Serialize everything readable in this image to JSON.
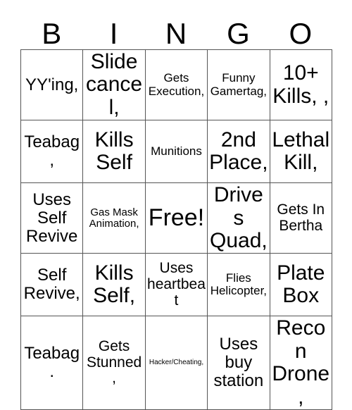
{
  "card": {
    "header_letters": [
      "B",
      "I",
      "N",
      "G",
      "O"
    ],
    "rows": [
      [
        {
          "text": "YY'ing,",
          "size": "xl"
        },
        {
          "text": "Slide cancel,",
          "size": "xxl"
        },
        {
          "text": "Gets Execution,",
          "size": "md"
        },
        {
          "text": "Funny Gamertag,",
          "size": "md"
        },
        {
          "text": "10+ Kills, ,",
          "size": "xxl"
        }
      ],
      [
        {
          "text": "Teabag,",
          "size": "xl"
        },
        {
          "text": "Kills Self",
          "size": "xxl"
        },
        {
          "text": "Munitions",
          "size": "md"
        },
        {
          "text": "2nd Place,",
          "size": "xxl"
        },
        {
          "text": "Lethal Kill,",
          "size": "xxl"
        }
      ],
      [
        {
          "text": "Uses Self Revive",
          "size": "xl"
        },
        {
          "text": "Gas Mask Animation,",
          "size": "sm"
        },
        {
          "text": "Free!",
          "size": "free"
        },
        {
          "text": "Drives Quad,",
          "size": "xxl"
        },
        {
          "text": "Gets In Bertha",
          "size": "lg"
        }
      ],
      [
        {
          "text": "Self Revive,",
          "size": "xl"
        },
        {
          "text": "Kills Self,",
          "size": "xxl"
        },
        {
          "text": "Uses heartbeat",
          "size": "lg"
        },
        {
          "text": "Flies Helicopter,",
          "size": "md"
        },
        {
          "text": "Plate Box",
          "size": "xxl"
        }
      ],
      [
        {
          "text": "Teabag.",
          "size": "xl"
        },
        {
          "text": "Gets Stunned,",
          "size": "lg"
        },
        {
          "text": "Hacker/Cheating,",
          "size": "xs"
        },
        {
          "text": "Uses buy station",
          "size": "xl"
        },
        {
          "text": "Recon Drone,",
          "size": "xxl"
        }
      ]
    ]
  },
  "colors": {
    "background": "#ffffff",
    "text": "#000000",
    "grid_line": "#555555"
  }
}
